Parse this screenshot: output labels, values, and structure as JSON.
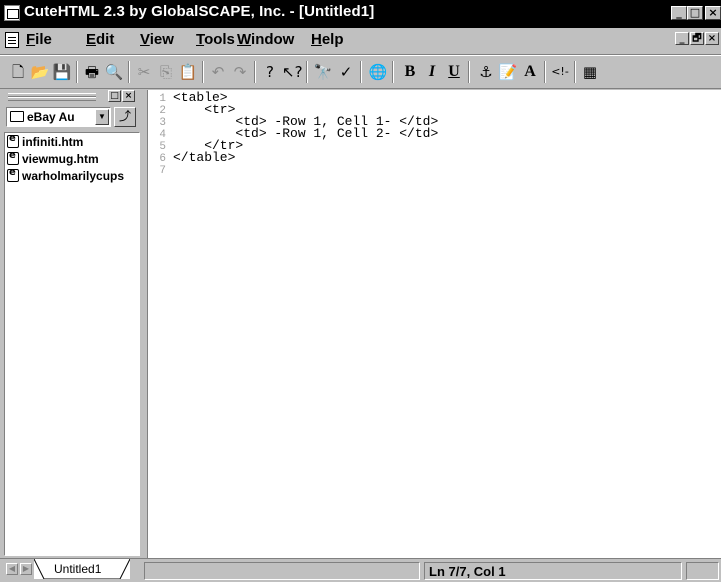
{
  "window": {
    "title": "CuteHTML 2.3 by GlobalSCAPE, Inc. - [Untitled1]",
    "controls": {
      "minimize": "_",
      "maximize": "□",
      "close": "×"
    }
  },
  "menu": {
    "items": [
      "File",
      "Edit",
      "View",
      "Tools",
      "Window",
      "Help"
    ],
    "mdi_controls": {
      "minimize": "_",
      "restore": "🗗",
      "close": "×"
    }
  },
  "toolbar": {
    "bold": "B",
    "italic": "I",
    "underline": "U",
    "font": "A"
  },
  "left_panel": {
    "folder_combo": "eBay Au",
    "files": [
      "infiniti.htm",
      "viewmug.htm",
      "warholmarilycups"
    ]
  },
  "editor": {
    "lines": [
      {
        "num": "1",
        "text": "<table>"
      },
      {
        "num": "2",
        "text": "    <tr>"
      },
      {
        "num": "3",
        "text": "        <td> -Row 1, Cell 1- </td>"
      },
      {
        "num": "4",
        "text": "        <td> -Row 1, Cell 2- </td>"
      },
      {
        "num": "5",
        "text": "    </tr>"
      },
      {
        "num": "6",
        "text": "</table>"
      },
      {
        "num": "7",
        "text": ""
      }
    ]
  },
  "tabs": [
    {
      "label": "Untitled1"
    }
  ],
  "status": {
    "position": "Ln 7/7, Col 1"
  }
}
